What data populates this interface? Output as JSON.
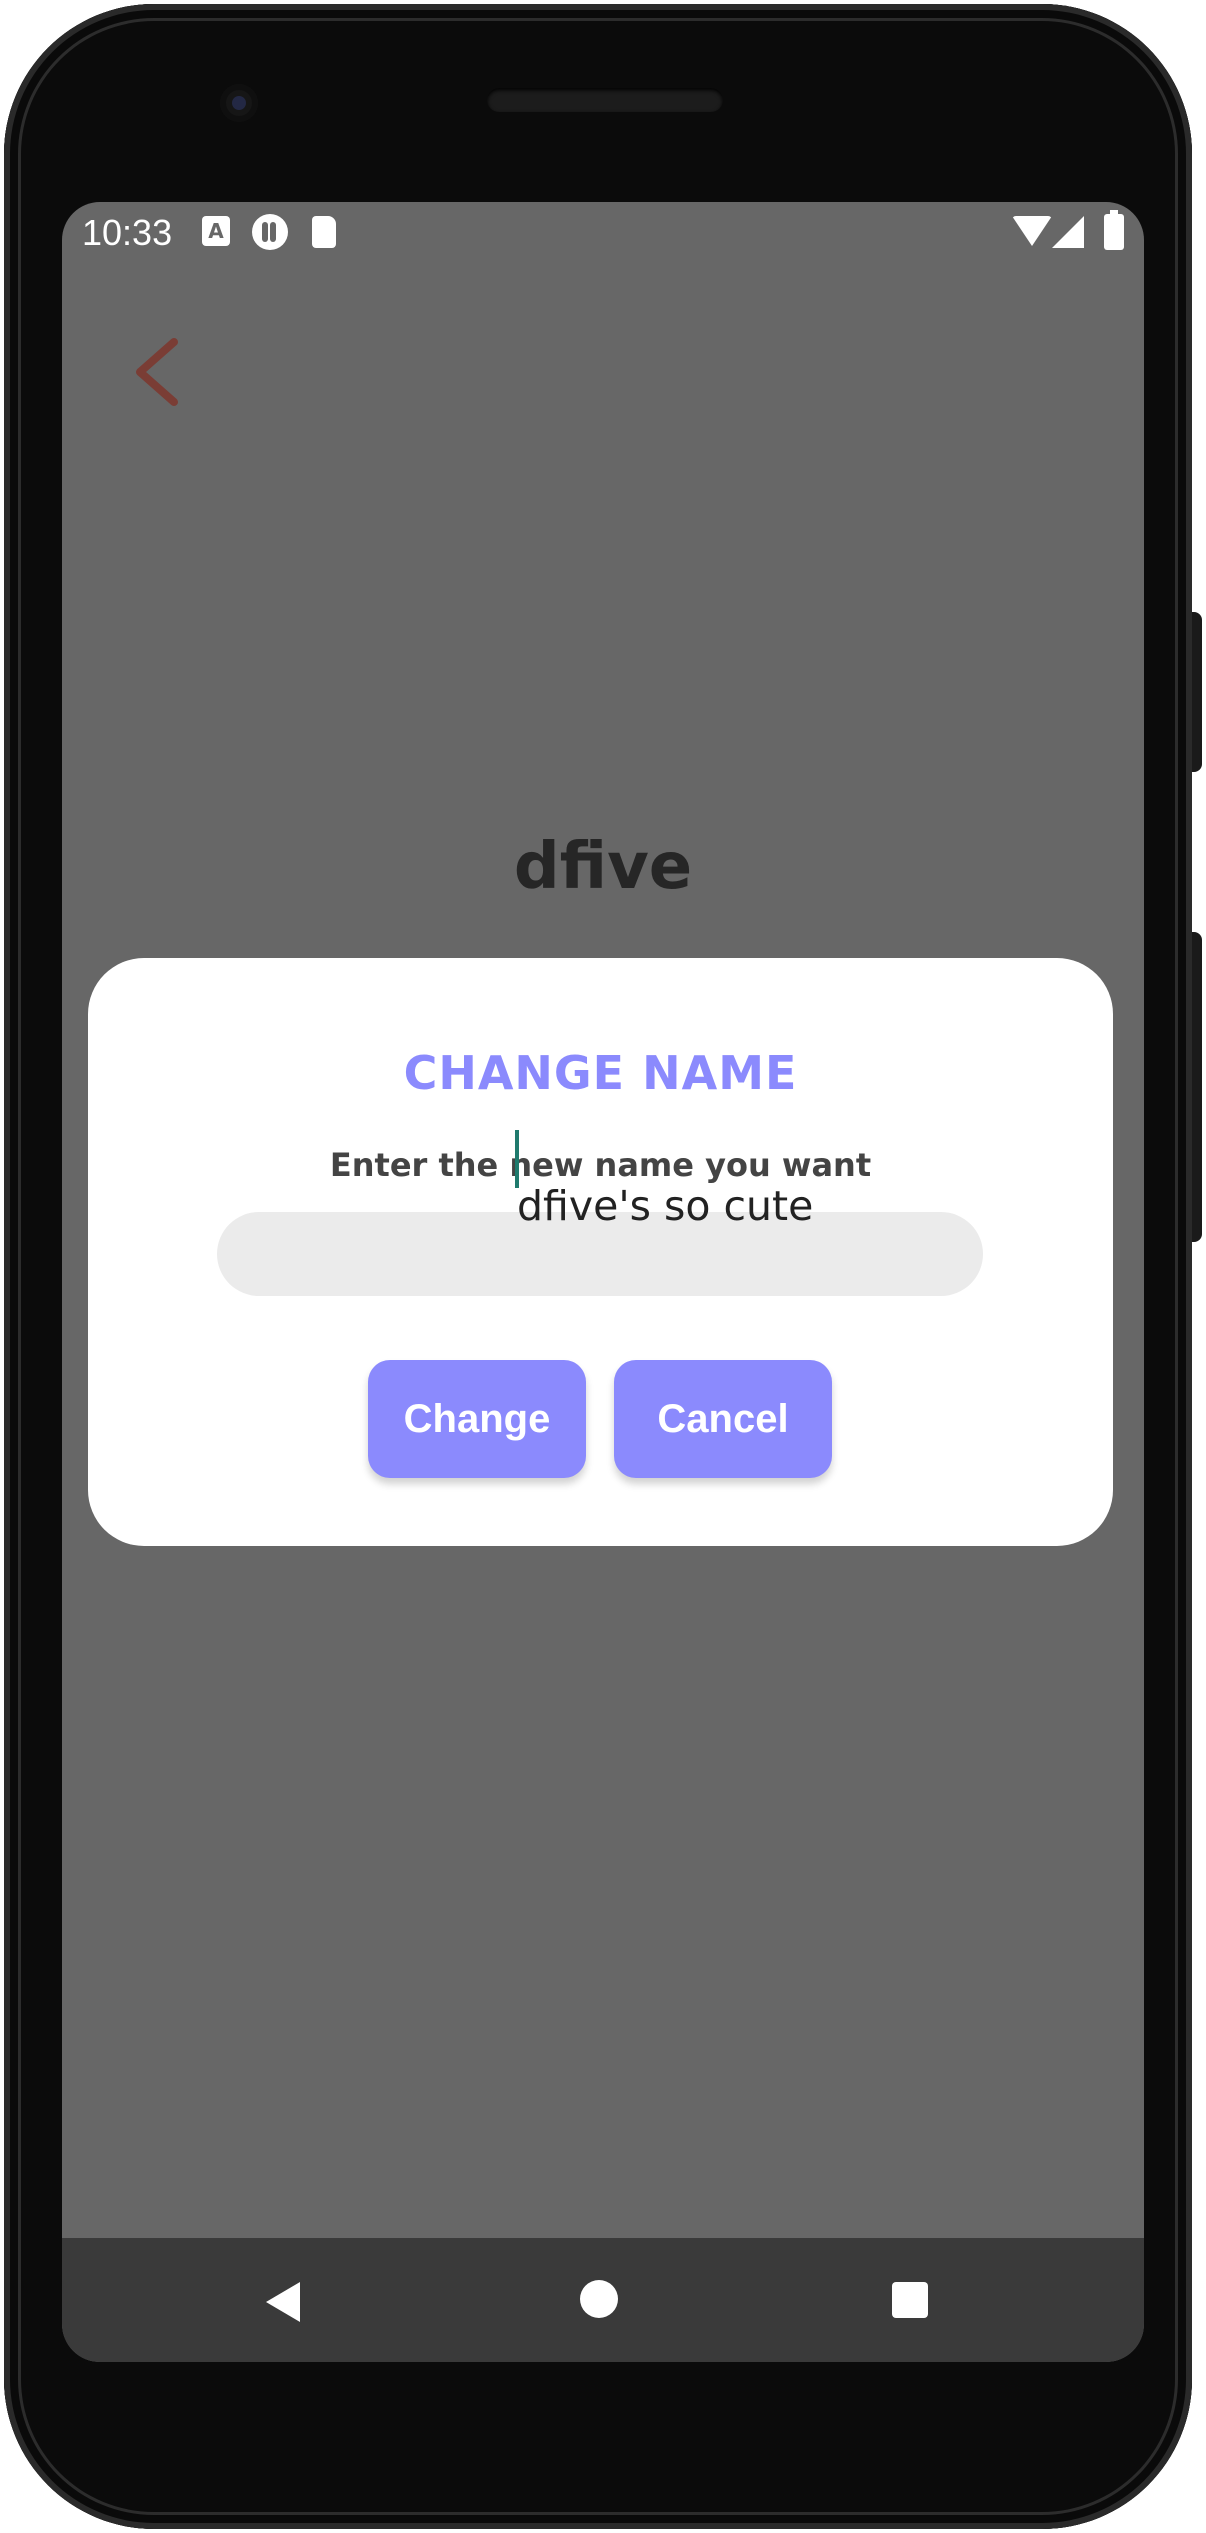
{
  "status_bar": {
    "time": "10:33",
    "icons": [
      "text-a-icon",
      "r-app-icon",
      "sd-card-icon",
      "wifi-icon",
      "signal-icon",
      "battery-icon"
    ],
    "notification_a": "A"
  },
  "header": {
    "back_icon": "chevron-left-icon",
    "back_icon_color": "#7a3d35"
  },
  "profile": {
    "username": "dfive"
  },
  "dialog": {
    "title": "CHANGE NAME",
    "subtitle": "Enter the new name you want",
    "input_value": "dfive's so cute",
    "change_label": "Change",
    "cancel_label": "Cancel",
    "accent_color": "#8b8afd"
  },
  "nav_bar": {
    "icons": [
      "back-triangle-icon",
      "home-circle-icon",
      "recents-square-icon"
    ]
  }
}
